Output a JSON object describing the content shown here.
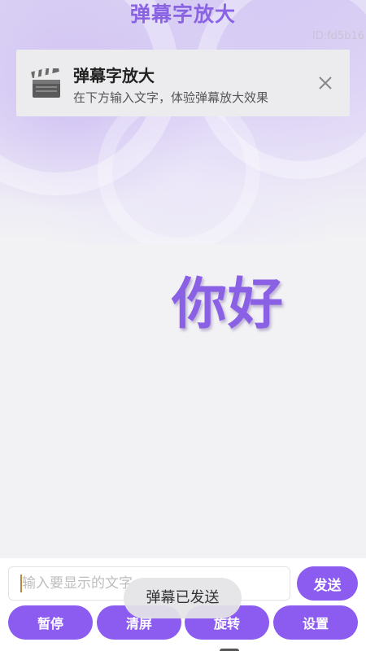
{
  "header": {
    "title": "弹幕字放大",
    "device_id": "ID:fd5b16"
  },
  "notice": {
    "icon": "clapperboard-icon",
    "title": "弹幕字放大",
    "body": "在下方输入文字，体验弹幕放大效果",
    "close_icon": "close-icon"
  },
  "display": {
    "text": "你好",
    "color": "#8a60e5"
  },
  "input": {
    "value": "",
    "placeholder": "输入要显示的文字"
  },
  "buttons": {
    "send": "发送",
    "pause": "暂停",
    "clear": "清屏",
    "rotate": "旋转",
    "settings": "设置"
  },
  "toast": "弹幕已发送",
  "colors": {
    "accent": "#8c5cf0",
    "title": "#8a63e4"
  }
}
